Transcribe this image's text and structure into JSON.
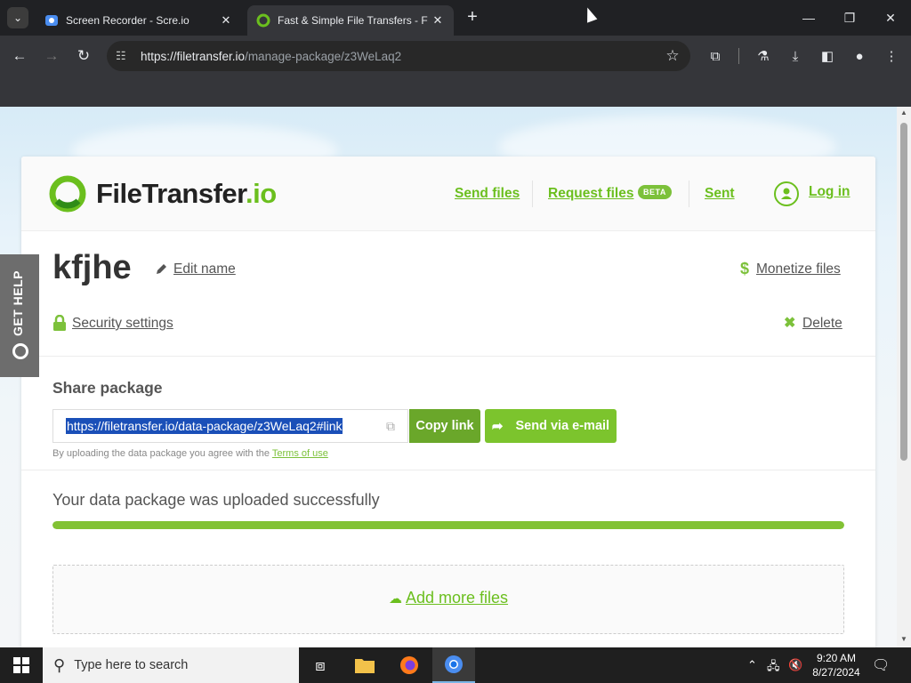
{
  "browser": {
    "tabs": [
      {
        "title": "Screen Recorder - Scre.io",
        "active": false
      },
      {
        "title": "Fast & Simple File Transfers - F",
        "active": true
      }
    ],
    "new_tab": "+",
    "url_host": "https://filetransfer.io",
    "url_path": "/manage-package/z3WeLaq2"
  },
  "header": {
    "logo_main": "FileTransfer",
    "logo_suffix": ".io",
    "nav": {
      "send_files": "Send files",
      "request_files": "Request files",
      "beta": "BETA",
      "sent": "Sent",
      "login": "Log in"
    }
  },
  "package": {
    "name": "kfjhe",
    "edit_name": "Edit name",
    "monetize": "Monetize files",
    "security": "Security settings",
    "delete": "Delete"
  },
  "share": {
    "label": "Share package",
    "link": "https://filetransfer.io/data-package/z3WeLaq2#link",
    "copy_button": "Copy link",
    "email_button": "Send via e-mail",
    "agree_text": "By uploading the data package you agree with the",
    "terms_link": "Terms of use"
  },
  "upload": {
    "message": "Your data package was uploaded successfully",
    "progress_percent": 100,
    "add_more": "Add more files"
  },
  "gethelp": "GET HELP",
  "taskbar": {
    "search_placeholder": "Type here to search",
    "time": "9:20 AM",
    "date": "8/27/2024"
  },
  "colors": {
    "brand_green": "#6bbf1e",
    "copy_button": "#6aa72a",
    "email_button": "#7cc42d",
    "selection": "#1a4fb8"
  }
}
